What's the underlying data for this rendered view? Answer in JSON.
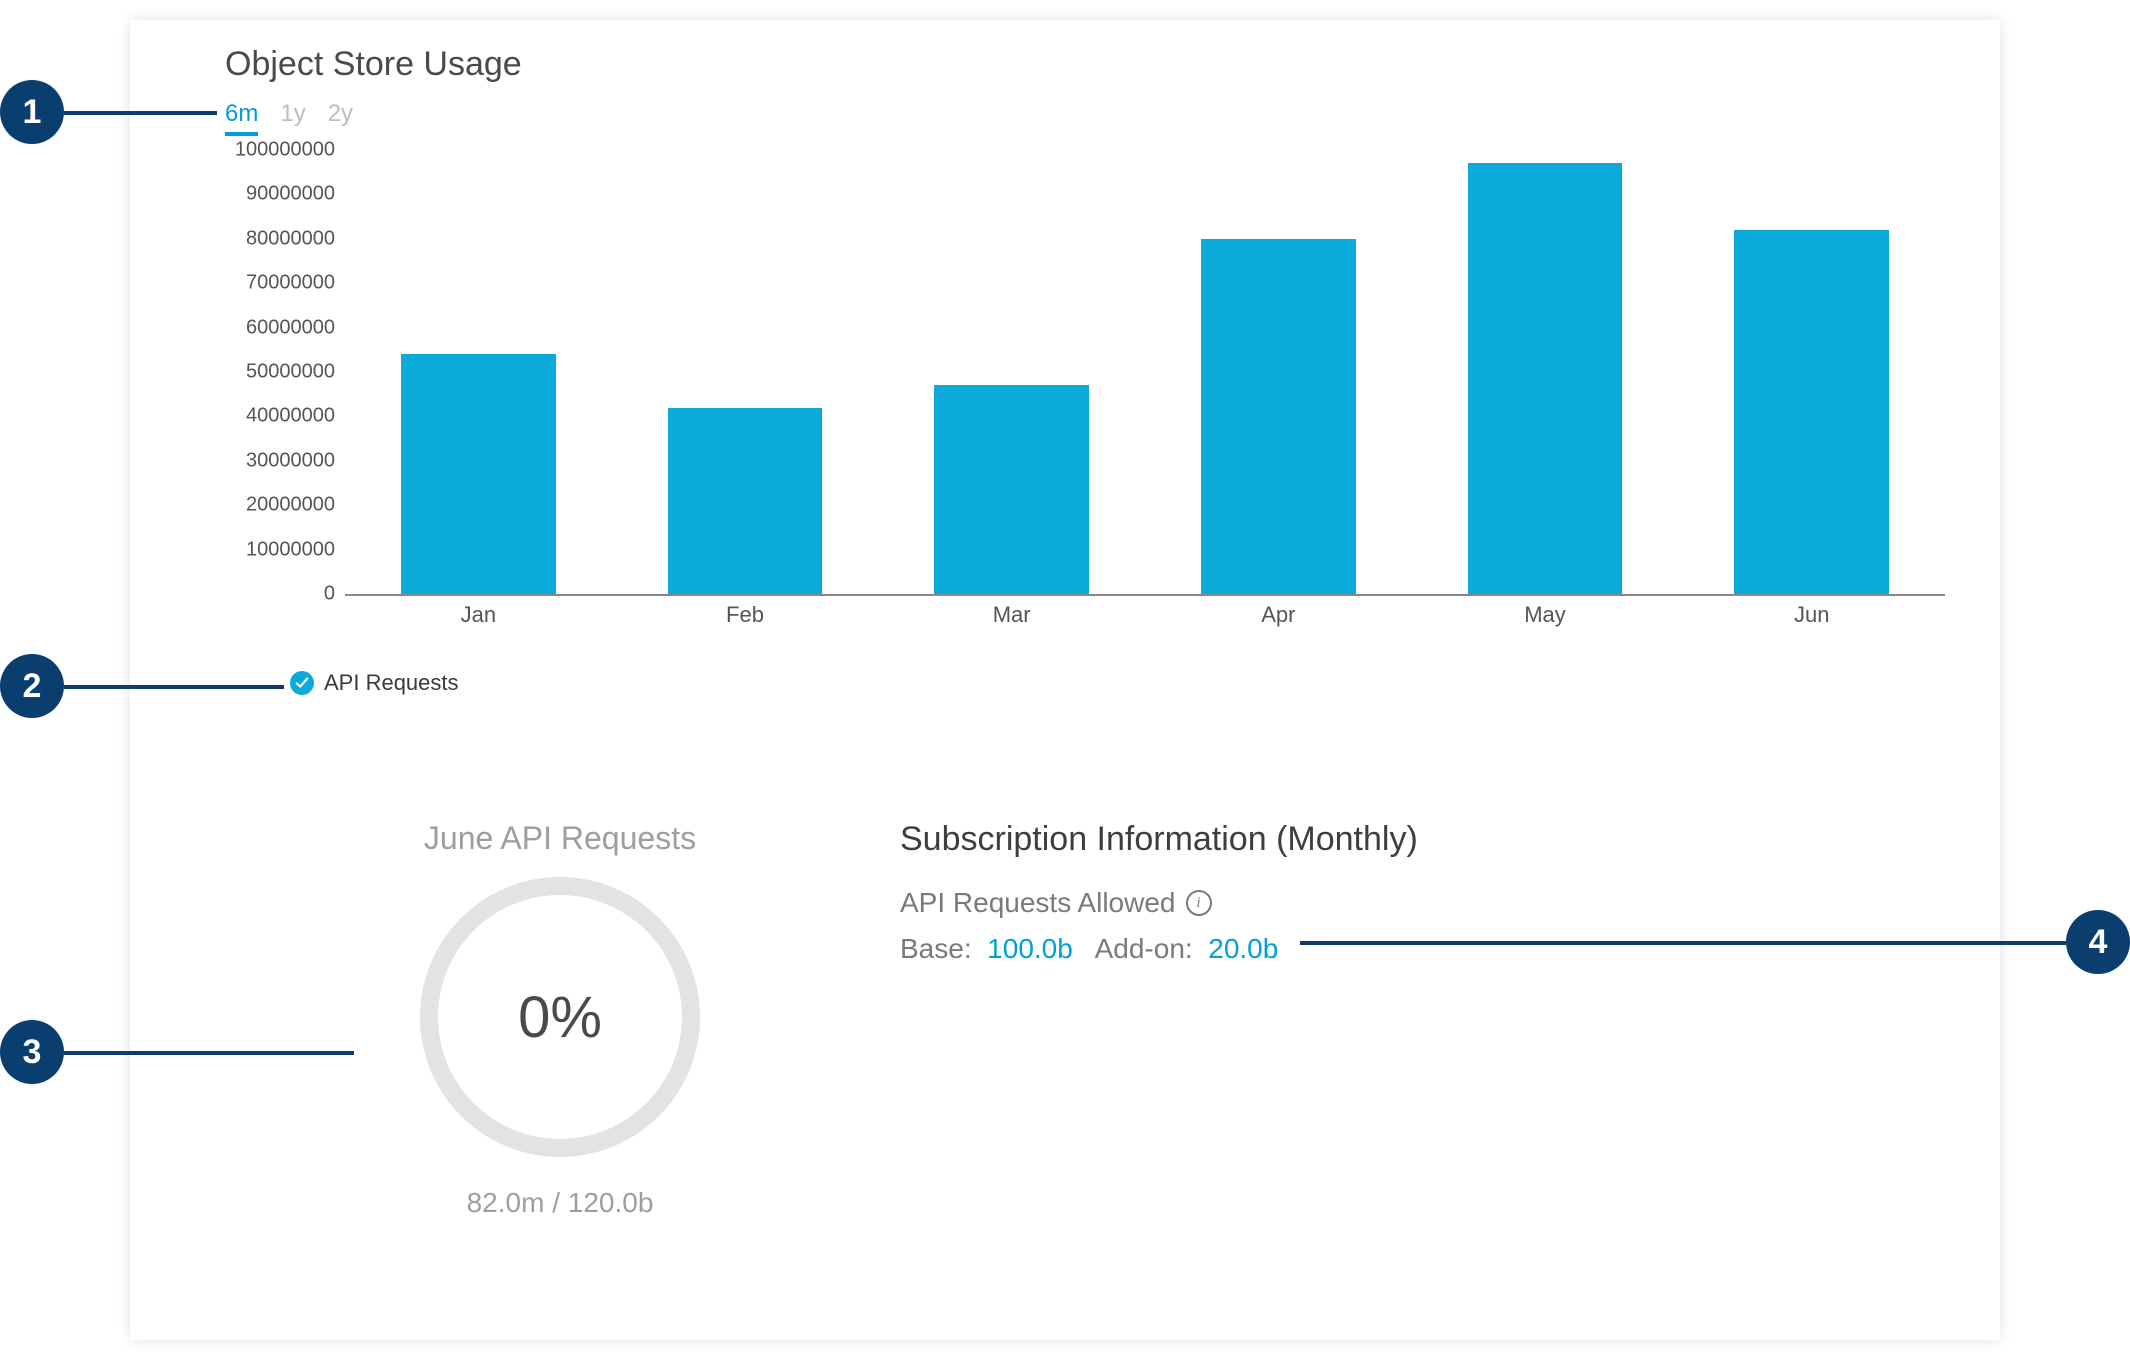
{
  "title": "Object Store Usage",
  "tabs": {
    "items": [
      "6m",
      "1y",
      "2y"
    ],
    "active_index": 0
  },
  "chart_data": {
    "type": "bar",
    "title": "Object Store Usage",
    "xlabel": "",
    "ylabel": "",
    "ylim": [
      0,
      100000000
    ],
    "y_ticks": [
      0,
      10000000,
      20000000,
      30000000,
      40000000,
      50000000,
      60000000,
      70000000,
      80000000,
      90000000,
      100000000
    ],
    "categories": [
      "Jan",
      "Feb",
      "Mar",
      "Apr",
      "May",
      "Jun"
    ],
    "series": [
      {
        "name": "API Requests",
        "values": [
          54000000,
          42000000,
          47000000,
          80000000,
          97000000,
          82000000
        ]
      }
    ],
    "legend_position": "bottom-left"
  },
  "gauge": {
    "title": "June API Requests",
    "percent_label": "0%",
    "subtext": "82.0m / 120.0b"
  },
  "subscription": {
    "title": "Subscription Information (Monthly)",
    "allowed_label": "API Requests Allowed",
    "base_label": "Base:",
    "base_value": "100.0b",
    "addon_label": "Add-on:",
    "addon_value": "20.0b"
  },
  "callouts": {
    "c1": "1",
    "c2": "2",
    "c3": "3",
    "c4": "4"
  },
  "colors": {
    "bar": "#0ca9db",
    "accent": "#009fd8",
    "callout": "#0a3e6e"
  }
}
